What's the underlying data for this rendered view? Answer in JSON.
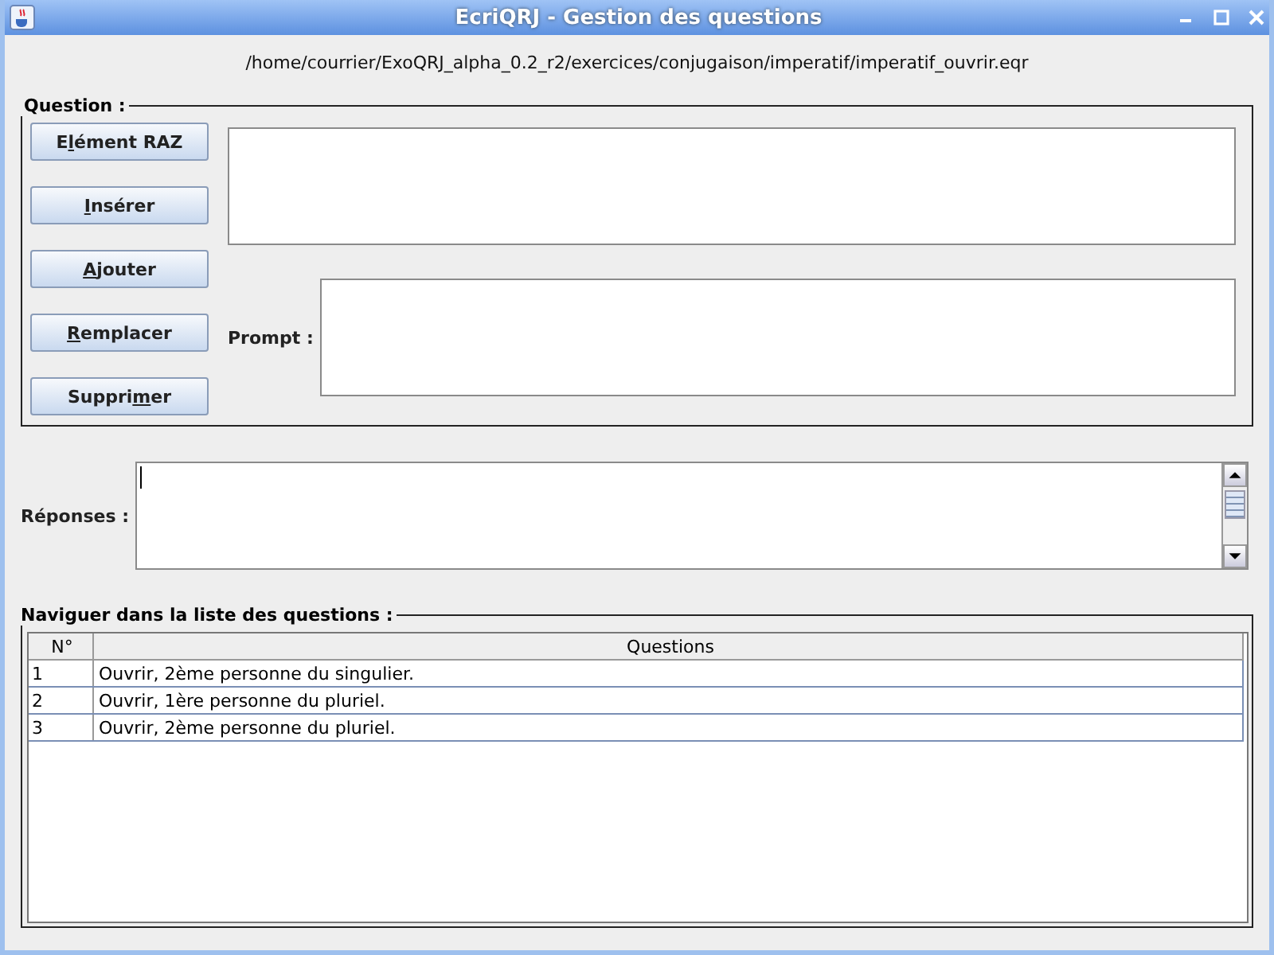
{
  "window": {
    "title": "EcriQRJ - Gestion des questions"
  },
  "file_path": "/home/courrier/ExoQRJ_alpha_0.2_r2/exercices/conjugaison/imperatif/imperatif_ouvrir.eqr",
  "question_panel": {
    "title": "Question :",
    "buttons": [
      {
        "before": "E",
        "key": "l",
        "after": "ément RAZ"
      },
      {
        "key": "I",
        "after": "nsérer"
      },
      {
        "key": "A",
        "after": "jouter"
      },
      {
        "key": "R",
        "after": "emplacer"
      },
      {
        "before": "Suppri",
        "key": "m",
        "after": "er"
      }
    ],
    "prompt_label": "Prompt :"
  },
  "answers": {
    "label": "Réponses :"
  },
  "navigation": {
    "title": "Naviguer dans la liste des questions :",
    "columns": [
      "N°",
      "Questions"
    ],
    "rows": [
      {
        "number": "1",
        "question": "Ouvrir, 2ème personne du singulier."
      },
      {
        "number": "2",
        "question": "Ouvrir, 1ère personne du pluriel."
      },
      {
        "number": "3",
        "question": "Ouvrir, 2ème personne du pluriel."
      }
    ]
  }
}
